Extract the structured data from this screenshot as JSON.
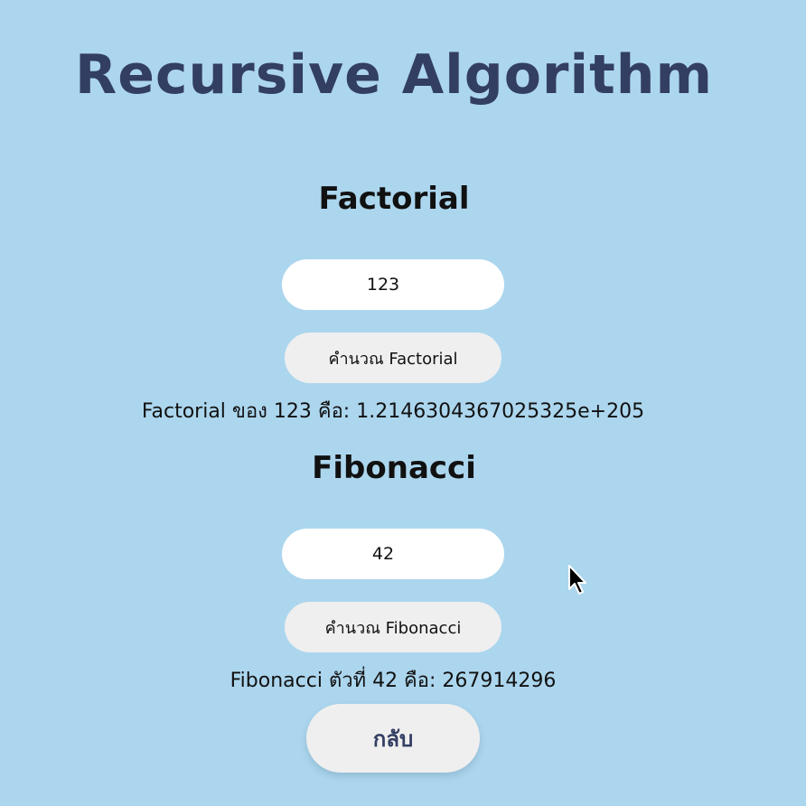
{
  "page": {
    "title": "Recursive Algorithm",
    "background_color": "#acd6ee",
    "title_color": "#333e63"
  },
  "factorial": {
    "heading": "Factorial",
    "input_value": "123",
    "button_label": "คำนวณ Factorial",
    "result_text": "Factorial ของ 123 คือ: 1.2146304367025325e+205"
  },
  "fibonacci": {
    "heading": "Fibonacci",
    "input_value": "42",
    "button_label": "คำนวณ Fibonacci",
    "result_text": "Fibonacci ตัวที่ 42 คือ: 267914296"
  },
  "back_button": {
    "label": "กลับ"
  },
  "icons": {
    "cursor": "mouse-pointer-icon"
  }
}
